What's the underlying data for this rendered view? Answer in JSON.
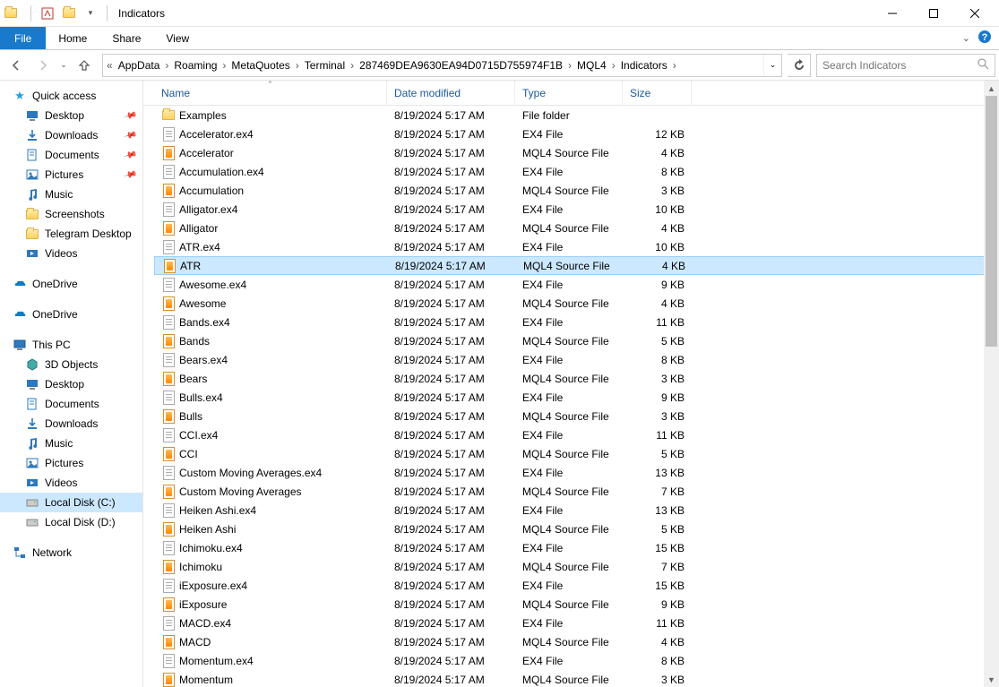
{
  "window": {
    "title": "Indicators"
  },
  "ribbon": {
    "file": "File",
    "home": "Home",
    "share": "Share",
    "view": "View"
  },
  "breadcrumb": {
    "prefix": "«",
    "items": [
      "AppData",
      "Roaming",
      "MetaQuotes",
      "Terminal",
      "287469DEA9630EA94D0715D755974F1B",
      "MQL4",
      "Indicators"
    ]
  },
  "search": {
    "placeholder": "Search Indicators"
  },
  "sidebar": {
    "quick": {
      "label": "Quick access",
      "items": [
        {
          "label": "Desktop",
          "pinned": true,
          "icon": "desktop"
        },
        {
          "label": "Downloads",
          "pinned": true,
          "icon": "downloads"
        },
        {
          "label": "Documents",
          "pinned": true,
          "icon": "documents"
        },
        {
          "label": "Pictures",
          "pinned": true,
          "icon": "pictures"
        },
        {
          "label": "Music",
          "pinned": false,
          "icon": "music"
        },
        {
          "label": "Screenshots",
          "pinned": false,
          "icon": "folder"
        },
        {
          "label": "Telegram Desktop",
          "pinned": false,
          "icon": "folder"
        },
        {
          "label": "Videos",
          "pinned": false,
          "icon": "videos"
        }
      ]
    },
    "onedrive1": "OneDrive",
    "onedrive2": "OneDrive",
    "thispc": {
      "label": "This PC",
      "items": [
        {
          "label": "3D Objects",
          "icon": "3d"
        },
        {
          "label": "Desktop",
          "icon": "desktop"
        },
        {
          "label": "Documents",
          "icon": "documents"
        },
        {
          "label": "Downloads",
          "icon": "downloads"
        },
        {
          "label": "Music",
          "icon": "music"
        },
        {
          "label": "Pictures",
          "icon": "pictures"
        },
        {
          "label": "Videos",
          "icon": "videos"
        },
        {
          "label": "Local Disk (C:)",
          "icon": "disk",
          "selected": true
        },
        {
          "label": "Local Disk (D:)",
          "icon": "disk"
        }
      ]
    },
    "network": "Network"
  },
  "columns": {
    "name": "Name",
    "date": "Date modified",
    "type": "Type",
    "size": "Size"
  },
  "files": [
    {
      "name": "Examples",
      "date": "8/19/2024 5:17 AM",
      "type": "File folder",
      "size": "",
      "icon": "folder"
    },
    {
      "name": "Accelerator.ex4",
      "date": "8/19/2024 5:17 AM",
      "type": "EX4 File",
      "size": "12 KB",
      "icon": "ex4"
    },
    {
      "name": "Accelerator",
      "date": "8/19/2024 5:17 AM",
      "type": "MQL4 Source File",
      "size": "4 KB",
      "icon": "mq4"
    },
    {
      "name": "Accumulation.ex4",
      "date": "8/19/2024 5:17 AM",
      "type": "EX4 File",
      "size": "8 KB",
      "icon": "ex4"
    },
    {
      "name": "Accumulation",
      "date": "8/19/2024 5:17 AM",
      "type": "MQL4 Source File",
      "size": "3 KB",
      "icon": "mq4"
    },
    {
      "name": "Alligator.ex4",
      "date": "8/19/2024 5:17 AM",
      "type": "EX4 File",
      "size": "10 KB",
      "icon": "ex4"
    },
    {
      "name": "Alligator",
      "date": "8/19/2024 5:17 AM",
      "type": "MQL4 Source File",
      "size": "4 KB",
      "icon": "mq4"
    },
    {
      "name": "ATR.ex4",
      "date": "8/19/2024 5:17 AM",
      "type": "EX4 File",
      "size": "10 KB",
      "icon": "ex4"
    },
    {
      "name": "ATR",
      "date": "8/19/2024 5:17 AM",
      "type": "MQL4 Source File",
      "size": "4 KB",
      "icon": "mq4",
      "selected": true
    },
    {
      "name": "Awesome.ex4",
      "date": "8/19/2024 5:17 AM",
      "type": "EX4 File",
      "size": "9 KB",
      "icon": "ex4"
    },
    {
      "name": "Awesome",
      "date": "8/19/2024 5:17 AM",
      "type": "MQL4 Source File",
      "size": "4 KB",
      "icon": "mq4"
    },
    {
      "name": "Bands.ex4",
      "date": "8/19/2024 5:17 AM",
      "type": "EX4 File",
      "size": "11 KB",
      "icon": "ex4"
    },
    {
      "name": "Bands",
      "date": "8/19/2024 5:17 AM",
      "type": "MQL4 Source File",
      "size": "5 KB",
      "icon": "mq4"
    },
    {
      "name": "Bears.ex4",
      "date": "8/19/2024 5:17 AM",
      "type": "EX4 File",
      "size": "8 KB",
      "icon": "ex4"
    },
    {
      "name": "Bears",
      "date": "8/19/2024 5:17 AM",
      "type": "MQL4 Source File",
      "size": "3 KB",
      "icon": "mq4"
    },
    {
      "name": "Bulls.ex4",
      "date": "8/19/2024 5:17 AM",
      "type": "EX4 File",
      "size": "9 KB",
      "icon": "ex4"
    },
    {
      "name": "Bulls",
      "date": "8/19/2024 5:17 AM",
      "type": "MQL4 Source File",
      "size": "3 KB",
      "icon": "mq4"
    },
    {
      "name": "CCI.ex4",
      "date": "8/19/2024 5:17 AM",
      "type": "EX4 File",
      "size": "11 KB",
      "icon": "ex4"
    },
    {
      "name": "CCI",
      "date": "8/19/2024 5:17 AM",
      "type": "MQL4 Source File",
      "size": "5 KB",
      "icon": "mq4"
    },
    {
      "name": "Custom Moving Averages.ex4",
      "date": "8/19/2024 5:17 AM",
      "type": "EX4 File",
      "size": "13 KB",
      "icon": "ex4"
    },
    {
      "name": "Custom Moving Averages",
      "date": "8/19/2024 5:17 AM",
      "type": "MQL4 Source File",
      "size": "7 KB",
      "icon": "mq4"
    },
    {
      "name": "Heiken Ashi.ex4",
      "date": "8/19/2024 5:17 AM",
      "type": "EX4 File",
      "size": "13 KB",
      "icon": "ex4"
    },
    {
      "name": "Heiken Ashi",
      "date": "8/19/2024 5:17 AM",
      "type": "MQL4 Source File",
      "size": "5 KB",
      "icon": "mq4"
    },
    {
      "name": "Ichimoku.ex4",
      "date": "8/19/2024 5:17 AM",
      "type": "EX4 File",
      "size": "15 KB",
      "icon": "ex4"
    },
    {
      "name": "Ichimoku",
      "date": "8/19/2024 5:17 AM",
      "type": "MQL4 Source File",
      "size": "7 KB",
      "icon": "mq4"
    },
    {
      "name": "iExposure.ex4",
      "date": "8/19/2024 5:17 AM",
      "type": "EX4 File",
      "size": "15 KB",
      "icon": "ex4"
    },
    {
      "name": "iExposure",
      "date": "8/19/2024 5:17 AM",
      "type": "MQL4 Source File",
      "size": "9 KB",
      "icon": "mq4"
    },
    {
      "name": "MACD.ex4",
      "date": "8/19/2024 5:17 AM",
      "type": "EX4 File",
      "size": "11 KB",
      "icon": "ex4"
    },
    {
      "name": "MACD",
      "date": "8/19/2024 5:17 AM",
      "type": "MQL4 Source File",
      "size": "4 KB",
      "icon": "mq4"
    },
    {
      "name": "Momentum.ex4",
      "date": "8/19/2024 5:17 AM",
      "type": "EX4 File",
      "size": "8 KB",
      "icon": "ex4"
    },
    {
      "name": "Momentum",
      "date": "8/19/2024 5:17 AM",
      "type": "MQL4 Source File",
      "size": "3 KB",
      "icon": "mq4"
    }
  ]
}
